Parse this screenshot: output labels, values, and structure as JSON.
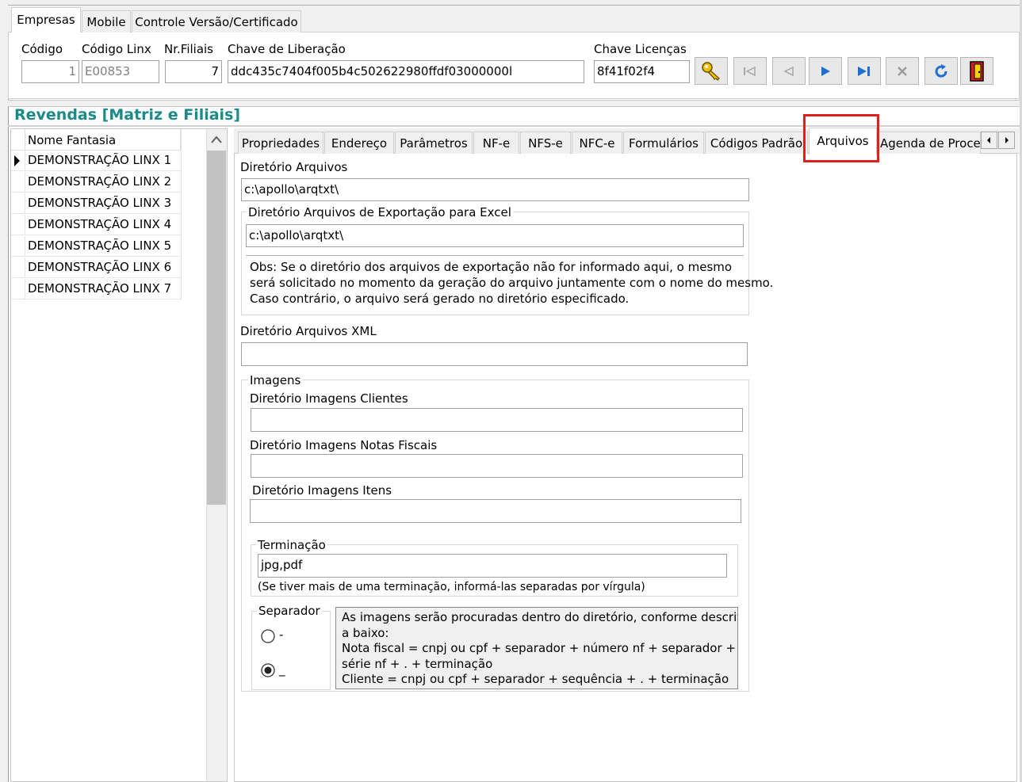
{
  "top_tabs": [
    {
      "label": "Empresas",
      "active": true
    },
    {
      "label": "Mobile",
      "active": false
    },
    {
      "label": "Controle Versão/Certificado",
      "active": false
    }
  ],
  "company": {
    "codigo_label": "Código",
    "codigo_value": "1",
    "codigo_linx_label": "Código Linx",
    "codigo_linx_value": "E00853",
    "nr_filiais_label": "Nr.Filiais",
    "nr_filiais_value": "7",
    "chave_liberacao_label": "Chave de Liberação",
    "chave_liberacao_value": "ddc435c7404f005b4c502622980ffdf03000000l",
    "chave_licencas_label": "Chave Licenças",
    "chave_licencas_value": "8f41f02f4"
  },
  "toolbar_icons": [
    "key-icon",
    "first-record-icon",
    "prior-record-icon",
    "next-record-icon",
    "last-record-icon",
    "cancel-icon",
    "refresh-icon",
    "exit-door-icon"
  ],
  "section_title": "Revendas [Matriz e Filiais]",
  "grid": {
    "header": "Nome Fantasia",
    "rows": [
      "DEMONSTRAÇÃO LINX 1",
      "DEMONSTRAÇÃO LINX 2",
      "DEMONSTRAÇÃO LINX 3",
      "DEMONSTRAÇÃO LINX 4",
      "DEMONSTRAÇÃO LINX 5",
      "DEMONSTRAÇÃO LINX 6",
      "DEMONSTRAÇÃO LINX 7"
    ]
  },
  "detail_tabs": [
    {
      "label": "Propriedades"
    },
    {
      "label": "Endereço"
    },
    {
      "label": "Parâmetros"
    },
    {
      "label": "NF-e"
    },
    {
      "label": "NFS-e"
    },
    {
      "label": "NFC-e"
    },
    {
      "label": "Formulários"
    },
    {
      "label": "Códigos Padrão"
    },
    {
      "label": "Arquivos"
    },
    {
      "label": "Agenda de Proce:"
    }
  ],
  "arquivos": {
    "dir_arquivos_label": "Diretório Arquivos",
    "dir_arquivos_value": "c:\\apollo\\arqtxt\\",
    "export_group_label": "Diretório Arquivos de Exportação para Excel",
    "export_value": "c:\\apollo\\arqtxt\\",
    "obs_lines": [
      "Obs: Se o diretório dos arquivos de exportação não  for informado aqui, o  mesmo",
      "será solicitado no momento da geração do arquivo juntamente com o nome do mesmo.",
      "Caso contrário,  o arquivo será gerado no diretório especificado."
    ],
    "xml_label": "Diretório Arquivos XML",
    "xml_value": "",
    "imagens_label": "Imagens",
    "img_clientes_label": "Diretório Imagens Clientes",
    "img_clientes_value": "",
    "img_notas_label": "Diretório Imagens Notas Fiscais",
    "img_notas_value": "",
    "img_itens_label": "Diretório Imagens Itens",
    "img_itens_value": "",
    "terminacao_label": "Terminação",
    "terminacao_value": "jpg,pdf",
    "terminacao_hint": "(Se tiver mais de uma terminação, informá-las separadas por vírgula)",
    "separador_label": "Separador",
    "separador_options": [
      {
        "label": "-",
        "selected": false
      },
      {
        "label": "_",
        "selected": true
      }
    ],
    "info_lines": [
      "As imagens serão procuradas dentro do diretório, conforme descrito",
      "a baixo:",
      "Nota fiscal = cnpj ou cpf  + separador  + número nf + separador  +",
      "série nf + . + terminação",
      "Cliente  = cnpj ou cpf + separador  + sequência + . + terminação"
    ]
  },
  "colors": {
    "section_title": "#1a8a8a",
    "highlight": "#e0201c",
    "nav_arrow": "#1f6fd0"
  }
}
